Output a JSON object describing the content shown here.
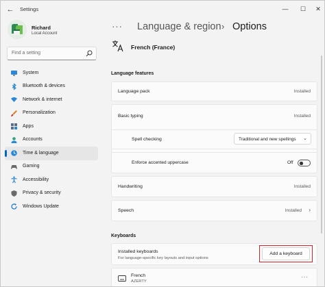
{
  "window": {
    "title": "Settings",
    "back_glyph": "←",
    "min_glyph": "—",
    "max_glyph": "☐",
    "close_glyph": "✕"
  },
  "profile": {
    "name": "Richard",
    "account_type": "Local Account"
  },
  "search": {
    "placeholder": "Find a setting"
  },
  "sidebar": {
    "items": [
      {
        "label": "System",
        "icon": "monitor-icon",
        "active": false
      },
      {
        "label": "Bluetooth & devices",
        "icon": "bluetooth-icon",
        "active": false
      },
      {
        "label": "Network & internet",
        "icon": "wifi-icon",
        "active": false
      },
      {
        "label": "Personalization",
        "icon": "brush-icon",
        "active": false
      },
      {
        "label": "Apps",
        "icon": "apps-icon",
        "active": false
      },
      {
        "label": "Accounts",
        "icon": "person-icon",
        "active": false
      },
      {
        "label": "Time & language",
        "icon": "globe-clock-icon",
        "active": true
      },
      {
        "label": "Gaming",
        "icon": "gamepad-icon",
        "active": false
      },
      {
        "label": "Accessibility",
        "icon": "accessibility-icon",
        "active": false
      },
      {
        "label": "Privacy & security",
        "icon": "shield-icon",
        "active": false
      },
      {
        "label": "Windows Update",
        "icon": "update-icon",
        "active": false
      }
    ]
  },
  "breadcrumb": {
    "overflow": "···",
    "parent": "Language & region",
    "separator": "›",
    "current": "Options"
  },
  "language": {
    "name": "French (France)"
  },
  "features": {
    "section_title": "Language features",
    "language_pack": {
      "label": "Language pack",
      "status": "Installed"
    },
    "basic_typing": {
      "label": "Basic typing",
      "status": "Installed",
      "spell_checking": {
        "label": "Spell checking",
        "value": "Traditional and new spellings",
        "chevron": "⌄"
      },
      "enforce_uppercase": {
        "label": "Enforce accented uppercase",
        "state": "Off"
      }
    },
    "handwriting": {
      "label": "Handwriting",
      "status": "Installed"
    },
    "speech": {
      "label": "Speech",
      "status": "Installed",
      "chevron": "›"
    }
  },
  "keyboards": {
    "section_title": "Keyboards",
    "installed_label": "Installed keyboards",
    "installed_sub": "For language-specific key layouts and input options",
    "add_button": "Add a keyboard",
    "highlight_color": "#d0242b",
    "items": [
      {
        "name": "French",
        "layout": "AZERTY",
        "more": "···"
      }
    ]
  },
  "colors": {
    "accent": "#0067c0"
  }
}
